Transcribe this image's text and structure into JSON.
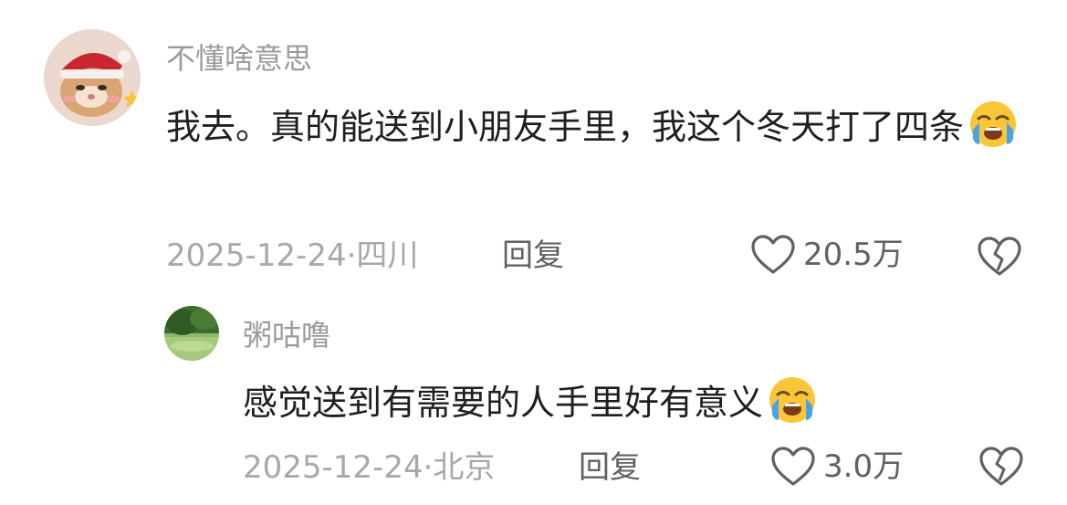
{
  "comments": [
    {
      "username": "不懂啥意思",
      "avatar": "cat-in-santa-hat-avatar",
      "text": "我去。真的能送到小朋友手里，我这个冬天打了四条",
      "emoji": "loudly-crying-face-emoji",
      "date": "2025-12-24",
      "location": "四川",
      "reply_label": "回复",
      "like_count": "20.5万"
    },
    {
      "username": "粥咕噜",
      "avatar": "green-tree-landscape-avatar",
      "text": "感觉送到有需要的人手里好有意义",
      "emoji": "loudly-crying-face-emoji",
      "date": "2025-12-24",
      "location": "北京",
      "reply_label": "回复",
      "like_count": "3.0万"
    }
  ],
  "colors": {
    "username": "#9b9b9b",
    "content": "#1f1f1f",
    "meta": "#a8a8a8",
    "action": "#616161"
  }
}
